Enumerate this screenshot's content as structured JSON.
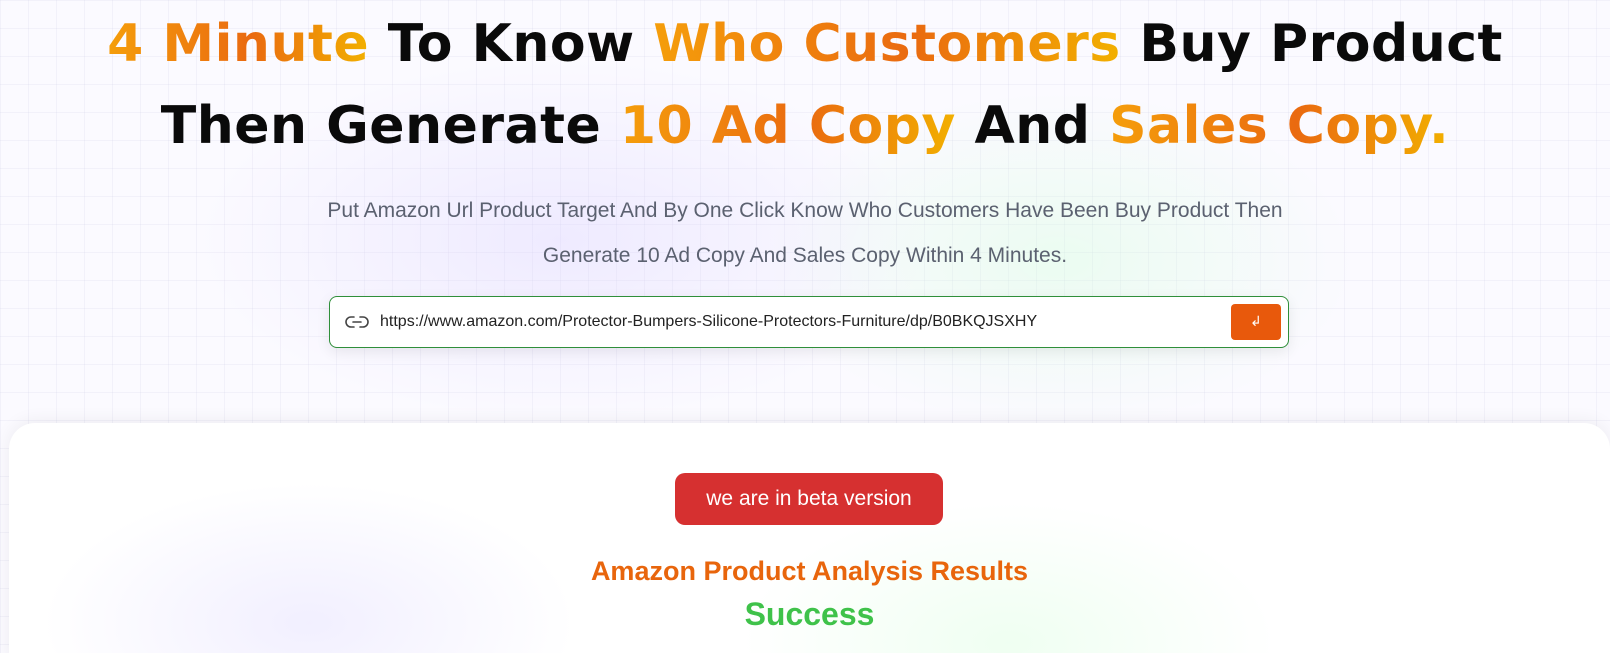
{
  "hero": {
    "line1": {
      "p1": "4 Minute",
      "p2": " To Know ",
      "p3": "Who Customers",
      "p4": " Buy Product"
    },
    "line2": {
      "p1": "Then Generate ",
      "p2": "10 Ad Copy",
      "p3": " And ",
      "p4": "Sales Copy."
    },
    "subtitle": "Put Amazon Url Product Target And By One Click Know Who Customers Have Been Buy Product Then Generate 10 Ad Copy And Sales Copy Within 4 Minutes."
  },
  "search": {
    "icon": "link-icon",
    "value": "https://www.amazon.com/Protector-Bumpers-Silicone-Protectors-Furniture/dp/B0BKQJSXHY",
    "submit_icon": "enter-icon",
    "submit_glyph": "↲"
  },
  "results": {
    "beta_badge": "we are in beta version",
    "title": "Amazon Product Analysis Results",
    "status": "Success"
  },
  "colors": {
    "accent_orange": "#e8590c",
    "gradient_start": "#f59e0b",
    "badge_red": "#d63030",
    "success_green": "#3fc24a",
    "input_border": "#2f8f3a"
  }
}
